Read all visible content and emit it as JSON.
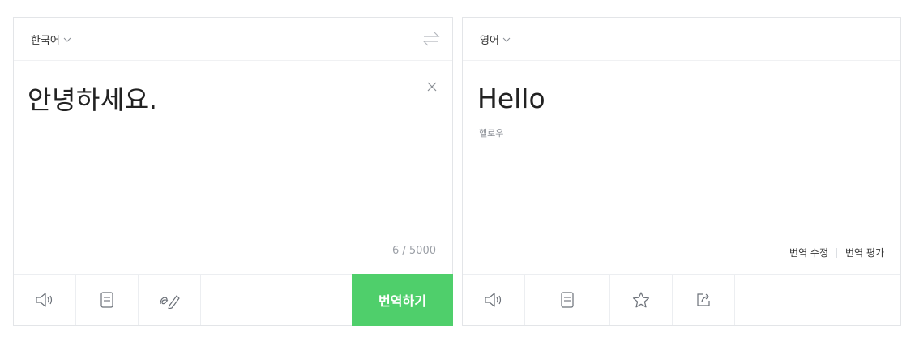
{
  "source": {
    "language": "한국어",
    "text": "안녕하세요.",
    "counter": "6 / 5000",
    "translate_button": "번역하기"
  },
  "target": {
    "language": "영어",
    "text": "Hello",
    "pronunciation": "헬로우",
    "edit_link": "번역 수정",
    "rate_link": "번역 평가"
  },
  "colors": {
    "accent": "#4fcf6b",
    "border": "#e3e5e8",
    "icon": "#6b7078"
  },
  "icons": {
    "source_toolbar": [
      "speaker-icon",
      "notes-icon",
      "handwriting-icon"
    ],
    "target_toolbar": [
      "speaker-icon",
      "notes-icon",
      "star-icon",
      "share-icon"
    ]
  }
}
